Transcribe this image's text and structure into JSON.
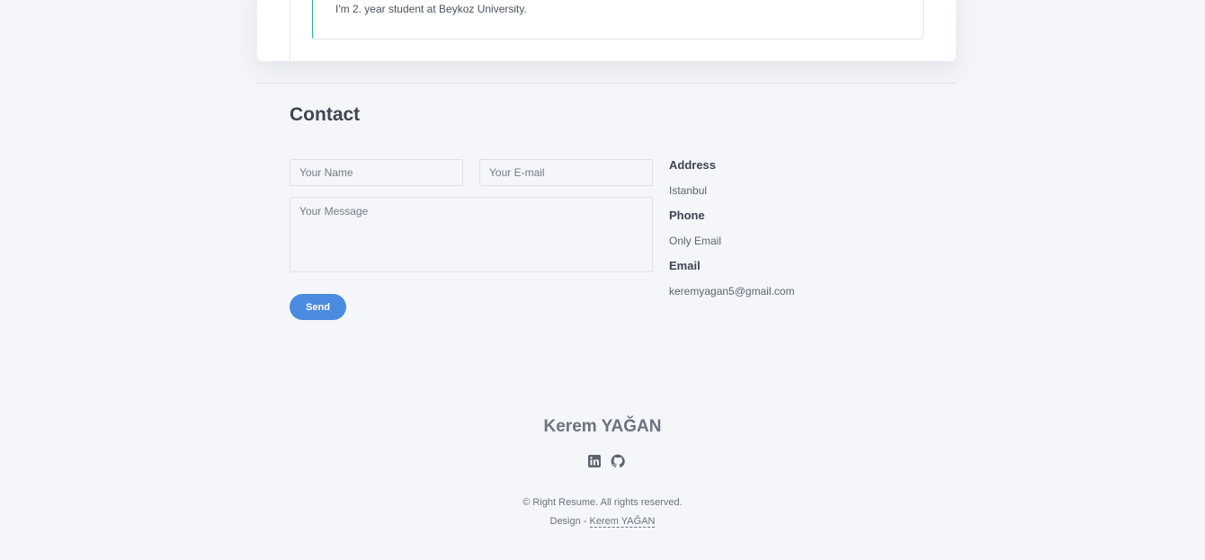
{
  "about": {
    "text": "I'm 2. year student at Beykoz University."
  },
  "contact": {
    "title": "Contact",
    "form": {
      "name_placeholder": "Your Name",
      "email_placeholder": "Your E-mail",
      "message_placeholder": "Your Message",
      "send_label": "Send"
    },
    "info": {
      "address_label": "Address",
      "address_value": "Istanbul",
      "phone_label": "Phone",
      "phone_value": "Only Email",
      "email_label": "Email",
      "email_value": "keremyagan5@gmail.com"
    }
  },
  "footer": {
    "name": "Kerem YAĞAN",
    "social": {
      "linkedin_icon": "linkedin-icon",
      "github_icon": "github-icon"
    },
    "copyright": "© Right Resume. All rights reserved.",
    "design_prefix": "Design - ",
    "design_link": "Kerem YAĞAN"
  },
  "colors": {
    "background": "#f4f6f9",
    "accent": "#4a8be0",
    "timeline_accent": "#2bb3a0"
  }
}
